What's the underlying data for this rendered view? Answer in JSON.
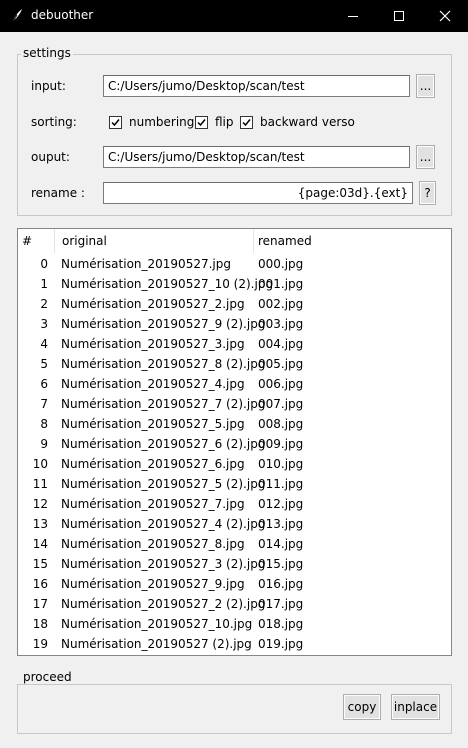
{
  "window": {
    "title": "debuother"
  },
  "settings": {
    "legend": "settings",
    "input_label": "input:",
    "input_value": "C:/Users/jumo/Desktop/scan/test",
    "input_browse": "...",
    "sorting_label": "sorting:",
    "opt_numbering": "numbering",
    "opt_flip": "flip",
    "opt_backward": "backward verso",
    "checked": {
      "numbering": true,
      "flip": true,
      "backward": true
    },
    "output_label": "ouput:",
    "output_value": "C:/Users/jumo/Desktop/scan/test",
    "output_browse": "...",
    "rename_label": "rename :",
    "rename_value": "{page:03d}.{ext}",
    "rename_help": "?"
  },
  "table": {
    "columns": [
      "#",
      "original",
      "renamed"
    ],
    "rows": [
      [
        "0",
        "Numérisation_20190527.jpg",
        "000.jpg"
      ],
      [
        "1",
        "Numérisation_20190527_10 (2).jpg",
        "001.jpg"
      ],
      [
        "2",
        "Numérisation_20190527_2.jpg",
        "002.jpg"
      ],
      [
        "3",
        "Numérisation_20190527_9 (2).jpg",
        "003.jpg"
      ],
      [
        "4",
        "Numérisation_20190527_3.jpg",
        "004.jpg"
      ],
      [
        "5",
        "Numérisation_20190527_8 (2).jpg",
        "005.jpg"
      ],
      [
        "6",
        "Numérisation_20190527_4.jpg",
        "006.jpg"
      ],
      [
        "7",
        "Numérisation_20190527_7 (2).jpg",
        "007.jpg"
      ],
      [
        "8",
        "Numérisation_20190527_5.jpg",
        "008.jpg"
      ],
      [
        "9",
        "Numérisation_20190527_6 (2).jpg",
        "009.jpg"
      ],
      [
        "10",
        "Numérisation_20190527_6.jpg",
        "010.jpg"
      ],
      [
        "11",
        "Numérisation_20190527_5 (2).jpg",
        "011.jpg"
      ],
      [
        "12",
        "Numérisation_20190527_7.jpg",
        "012.jpg"
      ],
      [
        "13",
        "Numérisation_20190527_4 (2).jpg",
        "013.jpg"
      ],
      [
        "14",
        "Numérisation_20190527_8.jpg",
        "014.jpg"
      ],
      [
        "15",
        "Numérisation_20190527_3 (2).jpg",
        "015.jpg"
      ],
      [
        "16",
        "Numérisation_20190527_9.jpg",
        "016.jpg"
      ],
      [
        "17",
        "Numérisation_20190527_2 (2).jpg",
        "017.jpg"
      ],
      [
        "18",
        "Numérisation_20190527_10.jpg",
        "018.jpg"
      ],
      [
        "19",
        "Numérisation_20190527 (2).jpg",
        "019.jpg"
      ]
    ]
  },
  "proceed": {
    "legend": "proceed",
    "copy": "copy",
    "inplace": "inplace"
  }
}
